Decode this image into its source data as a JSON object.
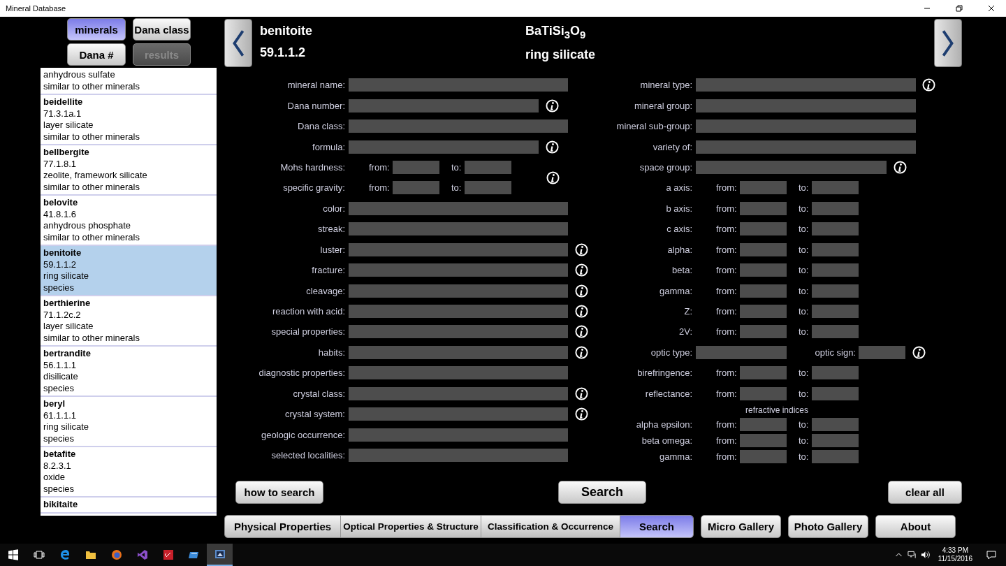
{
  "window": {
    "title": "Mineral Database"
  },
  "list_buttons": [
    {
      "label": "minerals",
      "selected": true,
      "disabled": false
    },
    {
      "label": "Dana class",
      "selected": false,
      "disabled": false
    },
    {
      "label": "Dana #",
      "selected": false,
      "disabled": false
    },
    {
      "label": "results",
      "selected": false,
      "disabled": true
    }
  ],
  "mineral_list": [
    {
      "lines": [
        "anhydrous sulfate",
        "similar to other minerals"
      ],
      "selected": false
    },
    {
      "title": "beidellite",
      "lines": [
        "71.3.1a.1",
        "layer silicate",
        "similar to other minerals"
      ],
      "selected": false
    },
    {
      "title": "bellbergite",
      "lines": [
        "77.1.8.1",
        "zeolite, framework silicate",
        "similar to other minerals"
      ],
      "selected": false
    },
    {
      "title": "belovite",
      "lines": [
        "41.8.1.6",
        "anhydrous phosphate",
        "similar to other minerals"
      ],
      "selected": false
    },
    {
      "title": "benitoite",
      "lines": [
        "59.1.1.2",
        "ring silicate",
        "species"
      ],
      "selected": true
    },
    {
      "title": "berthierine",
      "lines": [
        "71.1.2c.2",
        "layer silicate",
        "similar to other minerals"
      ],
      "selected": false
    },
    {
      "title": "bertrandite",
      "lines": [
        "56.1.1.1",
        "disilicate",
        "species"
      ],
      "selected": false
    },
    {
      "title": "beryl",
      "lines": [
        "61.1.1.1",
        "ring silicate",
        "species"
      ],
      "selected": false
    },
    {
      "title": "betafite",
      "lines": [
        "8.2.3.1",
        "oxide",
        "species"
      ],
      "selected": false
    },
    {
      "title": "bikitaite",
      "selected": false
    }
  ],
  "header": {
    "name": "benitoite",
    "dana_number": "59.1.1.2",
    "formula": "BaTiSi$_{3}$O$_{9}$",
    "class": "ring silicate"
  },
  "form_left": [
    {
      "kind": "text",
      "label": "mineral name:",
      "info": false
    },
    {
      "kind": "short_text",
      "label": "Dana number:",
      "info": true
    },
    {
      "kind": "text",
      "label": "Dana class:",
      "info": false
    },
    {
      "kind": "short_text",
      "label": "formula:",
      "info": true
    },
    {
      "kind": "range",
      "label": "Mohs hardness:",
      "from": "from:",
      "to": "to:",
      "info": true
    },
    {
      "kind": "range",
      "label": "specific gravity:",
      "from": "from:",
      "to": "to:",
      "info": false
    },
    {
      "kind": "text",
      "label": "color:",
      "info": false
    },
    {
      "kind": "text",
      "label": "streak:",
      "info": false
    },
    {
      "kind": "text",
      "label": "luster:",
      "info": true
    },
    {
      "kind": "text",
      "label": "fracture:",
      "info": true
    },
    {
      "kind": "text",
      "label": "cleavage:",
      "info": true
    },
    {
      "kind": "text",
      "label": "reaction with acid:",
      "info": true
    },
    {
      "kind": "text",
      "label": "special properties:",
      "info": true
    },
    {
      "kind": "text",
      "label": "habits:",
      "info": true
    },
    {
      "kind": "text",
      "label": "diagnostic properties:",
      "info": false
    },
    {
      "kind": "text",
      "label": "crystal class:",
      "info": true
    },
    {
      "kind": "text",
      "label": "crystal system:",
      "info": true
    },
    {
      "kind": "text",
      "label": "geologic occurrence:",
      "info": false
    },
    {
      "kind": "text",
      "label": "selected localities:",
      "info": false
    }
  ],
  "form_right": [
    {
      "kind": "text",
      "label": "mineral type:",
      "info": true
    },
    {
      "kind": "text",
      "label": "mineral group:",
      "info": false
    },
    {
      "kind": "text",
      "label": "mineral sub-group:",
      "info": false
    },
    {
      "kind": "text",
      "label": "variety of:",
      "info": false
    },
    {
      "kind": "short_text",
      "label": "space group:",
      "info": true
    },
    {
      "kind": "range",
      "label": "a axis:",
      "from": "from:",
      "to": "to:",
      "info": false
    },
    {
      "kind": "range",
      "label": "b axis:",
      "from": "from:",
      "to": "to:",
      "info": false
    },
    {
      "kind": "range",
      "label": "c axis:",
      "from": "from:",
      "to": "to:",
      "info": false
    },
    {
      "kind": "range",
      "label": "alpha:",
      "from": "from:",
      "to": "to:",
      "info": false
    },
    {
      "kind": "range",
      "label": "beta:",
      "from": "from:",
      "to": "to:",
      "info": false
    },
    {
      "kind": "range",
      "label": "gamma:",
      "from": "from:",
      "to": "to:",
      "info": false
    },
    {
      "kind": "range",
      "label": "Z:",
      "from": "from:",
      "to": "to:",
      "info": false
    },
    {
      "kind": "range",
      "label": "2V:",
      "from": "from:",
      "to": "to:",
      "info": false
    },
    {
      "kind": "pair",
      "label": "optic type:",
      "label2": "optic sign:",
      "info": true
    },
    {
      "kind": "range",
      "label": "birefringence:",
      "from": "from:",
      "to": "to:",
      "info": false
    },
    {
      "kind": "range",
      "label": "reflectance:",
      "from": "from:",
      "to": "to:",
      "info": false
    },
    {
      "kind": "group",
      "heading": "refractive indices",
      "rows": [
        {
          "label": "alpha epsilon:",
          "from": "from:",
          "to": "to:"
        },
        {
          "label": "beta omega:",
          "from": "from:",
          "to": "to:"
        },
        {
          "label": "gamma:",
          "from": "from:",
          "to": "to:"
        }
      ]
    }
  ],
  "actions": [
    "how to search",
    "Search",
    "clear all"
  ],
  "tabs": [
    {
      "label": "Physical Properties",
      "selected": false
    },
    {
      "label": "Optical Properties & Structure",
      "selected": false
    },
    {
      "label": "Classification & Occurrence",
      "selected": false
    },
    {
      "label": "Search",
      "selected": true
    }
  ],
  "nav_buttons": [
    "Micro Gallery",
    "Photo Gallery",
    "About"
  ],
  "taskbar": {
    "apps": [
      {
        "kind": "start",
        "active": false
      },
      {
        "kind": "taskview",
        "active": false
      },
      {
        "kind": "edge",
        "active": false
      },
      {
        "kind": "folder",
        "active": false
      },
      {
        "kind": "firefox",
        "active": false
      },
      {
        "kind": "vs",
        "active": false
      },
      {
        "kind": "red",
        "active": false
      },
      {
        "kind": "blue",
        "active": false
      },
      {
        "kind": "mineral",
        "active": true
      }
    ],
    "time": "4:33 PM",
    "date": "11/15/2016"
  }
}
